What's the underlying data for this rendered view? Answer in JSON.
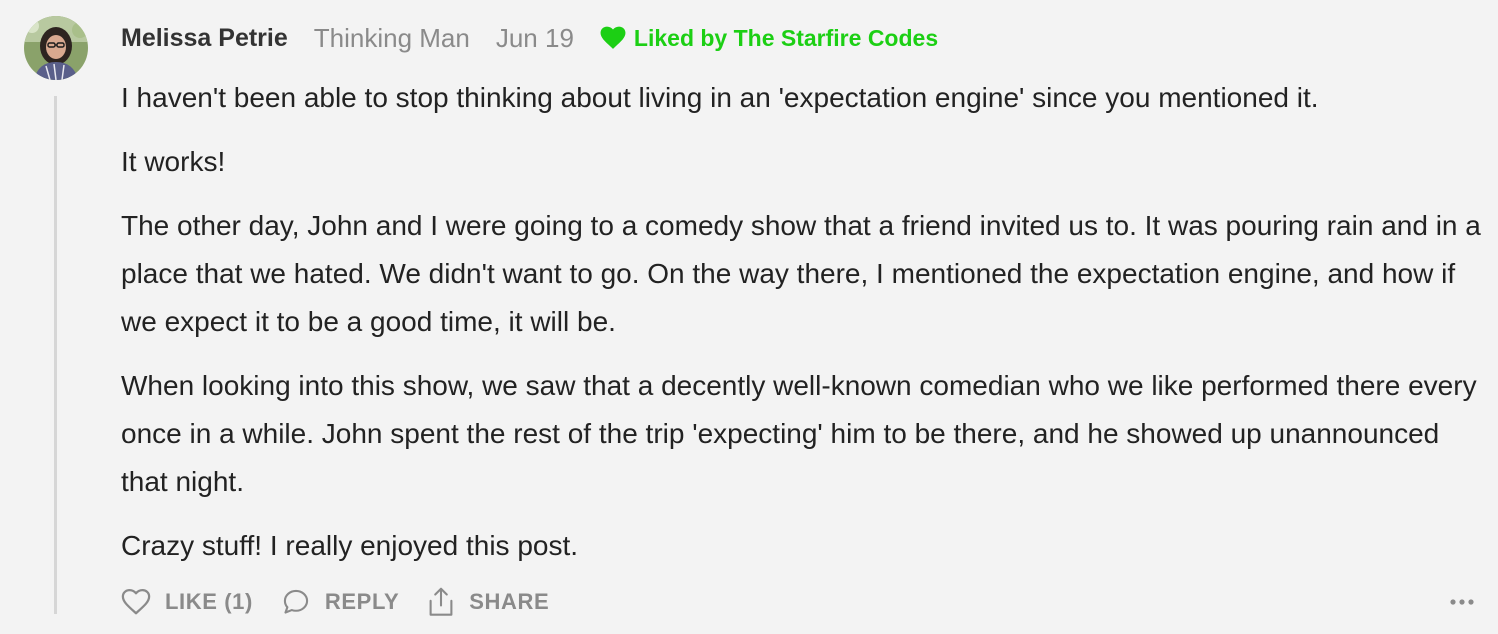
{
  "comment": {
    "author": "Melissa Petrie",
    "publication": "Thinking Man",
    "date": "Jun 19",
    "liked_by": "Liked by The Starfire Codes",
    "paragraphs": [
      "I haven't been able to stop thinking about living in an 'expectation engine' since you mentioned it.",
      "It works!",
      "The other day, John and I were going to a comedy show that a friend invited us to. It was pouring rain and in a place that we hated. We didn't want to go. On the way there, I mentioned the expectation engine, and how if we expect it to be a good time, it will be.",
      "When looking into this show, we saw that a decently well-known comedian who we like performed there every once in a while. John spent the rest of the trip 'expecting' him to be there, and he showed up unannounced that night.",
      "Crazy stuff! I really enjoyed this post."
    ]
  },
  "actions": {
    "like_label": "LIKE (1)",
    "reply_label": "REPLY",
    "share_label": "SHARE"
  },
  "colors": {
    "background": "#f3f3f3",
    "liked_green": "#1ccf14",
    "muted_gray": "#8a8a8a",
    "text": "#222222"
  },
  "icons": {
    "liked": "heart-icon",
    "like": "heart-outline-icon",
    "reply": "speech-bubble-icon",
    "share": "share-icon",
    "more": "more-dots-icon"
  }
}
